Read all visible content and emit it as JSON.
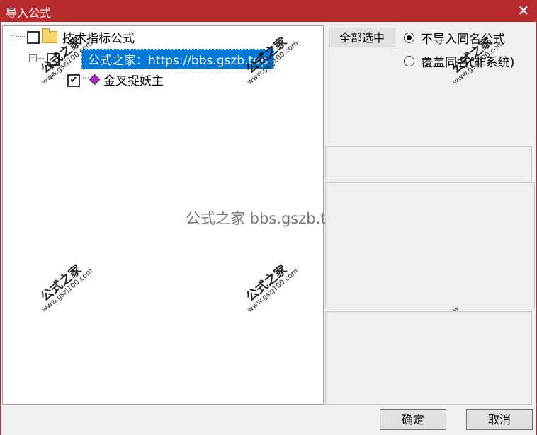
{
  "window": {
    "title": "导入公式",
    "close_glyph": "✕"
  },
  "tree": {
    "root": {
      "label": "技术指标公式",
      "expander": "⊟"
    },
    "group": {
      "label": "公式之家：https://bbs.gszb.top",
      "expander": "⊟"
    },
    "item": {
      "label": "金叉捉妖主",
      "checked": true,
      "check_glyph": "✔"
    }
  },
  "controls": {
    "select_all_label": "全部选中",
    "radio_options": [
      {
        "label": "不导入同名公式",
        "checked": true
      },
      {
        "label": "覆盖同名(非系统)",
        "checked": false
      }
    ]
  },
  "watermarks": {
    "cn": "公式之家",
    "url": "www.gszj100.com"
  },
  "center_watermark": "公式之家 bbs.gszb.top",
  "footer": {
    "ok_label": "确定",
    "cancel_label": "取消"
  },
  "colors": {
    "titlebar": "#b72b2e",
    "selection": "#0078d7",
    "gem": "#b028c8"
  }
}
